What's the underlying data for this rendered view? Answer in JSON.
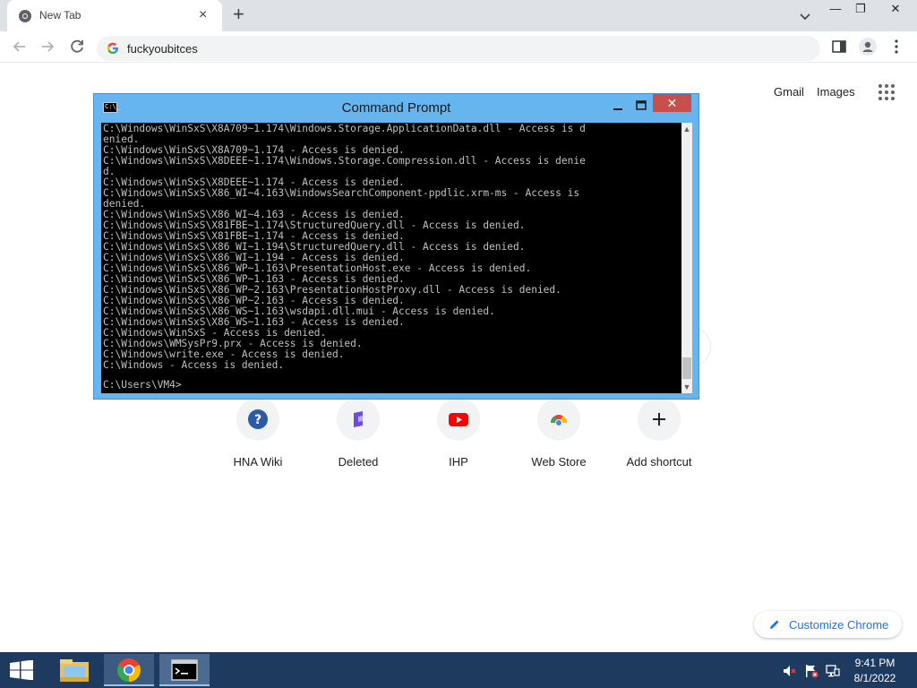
{
  "browser": {
    "tab": {
      "title": "New Tab",
      "favicon": "chrome-icon"
    },
    "window_controls": {
      "minimize": "—",
      "maximize": "❐",
      "close": "✕"
    },
    "address_bar": {
      "value": "fuckyoubitces",
      "icon": "google-g-icon"
    }
  },
  "ntp": {
    "header_links": {
      "gmail": "Gmail",
      "images": "Images"
    },
    "shortcuts": [
      {
        "label": "HNA Wiki",
        "icon": "help-circle-icon"
      },
      {
        "label": "Deleted",
        "icon": "deleted-site-icon"
      },
      {
        "label": "IHP",
        "icon": "youtube-icon"
      },
      {
        "label": "Web Store",
        "icon": "web-store-icon"
      },
      {
        "label": "Add shortcut",
        "icon": "plus-icon"
      }
    ],
    "customize_label": "Customize Chrome"
  },
  "cmd": {
    "title": "Command Prompt",
    "lines": [
      "C:\\Windows\\WinSxS\\X8A709~1.174\\Windows.Storage.ApplicationData.dll - Access is d",
      "enied.",
      "C:\\Windows\\WinSxS\\X8A709~1.174 - Access is denied.",
      "C:\\Windows\\WinSxS\\X8DEEE~1.174\\Windows.Storage.Compression.dll - Access is denie",
      "d.",
      "C:\\Windows\\WinSxS\\X8DEEE~1.174 - Access is denied.",
      "C:\\Windows\\WinSxS\\X86_WI~4.163\\WindowsSearchComponent-ppdlic.xrm-ms - Access is",
      "denied.",
      "C:\\Windows\\WinSxS\\X86_WI~4.163 - Access is denied.",
      "C:\\Windows\\WinSxS\\X81FBE~1.174\\StructuredQuery.dll - Access is denied.",
      "C:\\Windows\\WinSxS\\X81FBE~1.174 - Access is denied.",
      "C:\\Windows\\WinSxS\\X86_WI~1.194\\StructuredQuery.dll - Access is denied.",
      "C:\\Windows\\WinSxS\\X86_WI~1.194 - Access is denied.",
      "C:\\Windows\\WinSxS\\X86_WP~1.163\\PresentationHost.exe - Access is denied.",
      "C:\\Windows\\WinSxS\\X86_WP~1.163 - Access is denied.",
      "C:\\Windows\\WinSxS\\X86_WP~2.163\\PresentationHostProxy.dll - Access is denied.",
      "C:\\Windows\\WinSxS\\X86_WP~2.163 - Access is denied.",
      "C:\\Windows\\WinSxS\\X86_WS~1.163\\wsdapi.dll.mui - Access is denied.",
      "C:\\Windows\\WinSxS\\X86_WS~1.163 - Access is denied.",
      "C:\\Windows\\WinSxS - Access is denied.",
      "C:\\Windows\\WMSysPr9.prx - Access is denied.",
      "C:\\Windows\\write.exe - Access is denied.",
      "C:\\Windows - Access is denied."
    ],
    "prompt": "C:\\Users\\VM4>"
  },
  "taskbar": {
    "time": "9:41 PM",
    "date": "8/1/2022",
    "apps": [
      "file-explorer-icon",
      "chrome-icon",
      "command-prompt-icon"
    ]
  },
  "colors": {
    "cmd_frame": "#67b5ef",
    "cmd_close": "#c7504c",
    "console_text": "#c0c0c0",
    "taskbar": "#1f3a5f",
    "link_blue": "#1a73e8"
  }
}
